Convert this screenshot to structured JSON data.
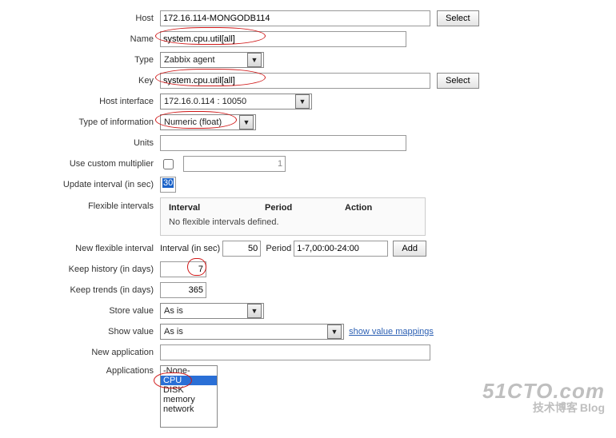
{
  "labels": {
    "host": "Host",
    "name": "Name",
    "type": "Type",
    "key": "Key",
    "host_interface": "Host interface",
    "type_info": "Type of information",
    "units": "Units",
    "use_mult": "Use custom multiplier",
    "update_int": "Update interval (in sec)",
    "flex_int": "Flexible intervals",
    "new_flex": "New flexible interval",
    "keep_hist": "Keep history (in days)",
    "keep_trends": "Keep trends (in days)",
    "store_value": "Store value",
    "show_value": "Show value",
    "new_app": "New application",
    "applications": "Applications"
  },
  "buttons": {
    "select": "Select",
    "add": "Add"
  },
  "flex_table": {
    "col_interval": "Interval",
    "col_period": "Period",
    "col_action": "Action",
    "empty": "No flexible intervals defined."
  },
  "new_flex_row": {
    "interval_label": "Interval (in sec)",
    "interval_value": "50",
    "period_label": "Period",
    "period_value": "1-7,00:00-24:00"
  },
  "values": {
    "host": "172.16.114-MONGODB114",
    "name": "system.cpu.util[all]",
    "type": "Zabbix agent",
    "key": "system.cpu.util[all]",
    "host_interface": "172.16.0.114 : 10050",
    "type_info": "Numeric (float)",
    "units": "",
    "multiplier": "1",
    "update_interval": "30",
    "keep_history": "7",
    "keep_trends": "365",
    "store_value": "As is",
    "show_value": "As is",
    "new_application": ""
  },
  "links": {
    "show_value_mappings": "show value mappings"
  },
  "app_list": [
    "-None-",
    "CPU",
    "DISK",
    "memory",
    "network"
  ],
  "app_selected_index": 1,
  "watermark": {
    "line1": "51CTO.com",
    "line2": "技术博客",
    "line3": "Blog"
  }
}
